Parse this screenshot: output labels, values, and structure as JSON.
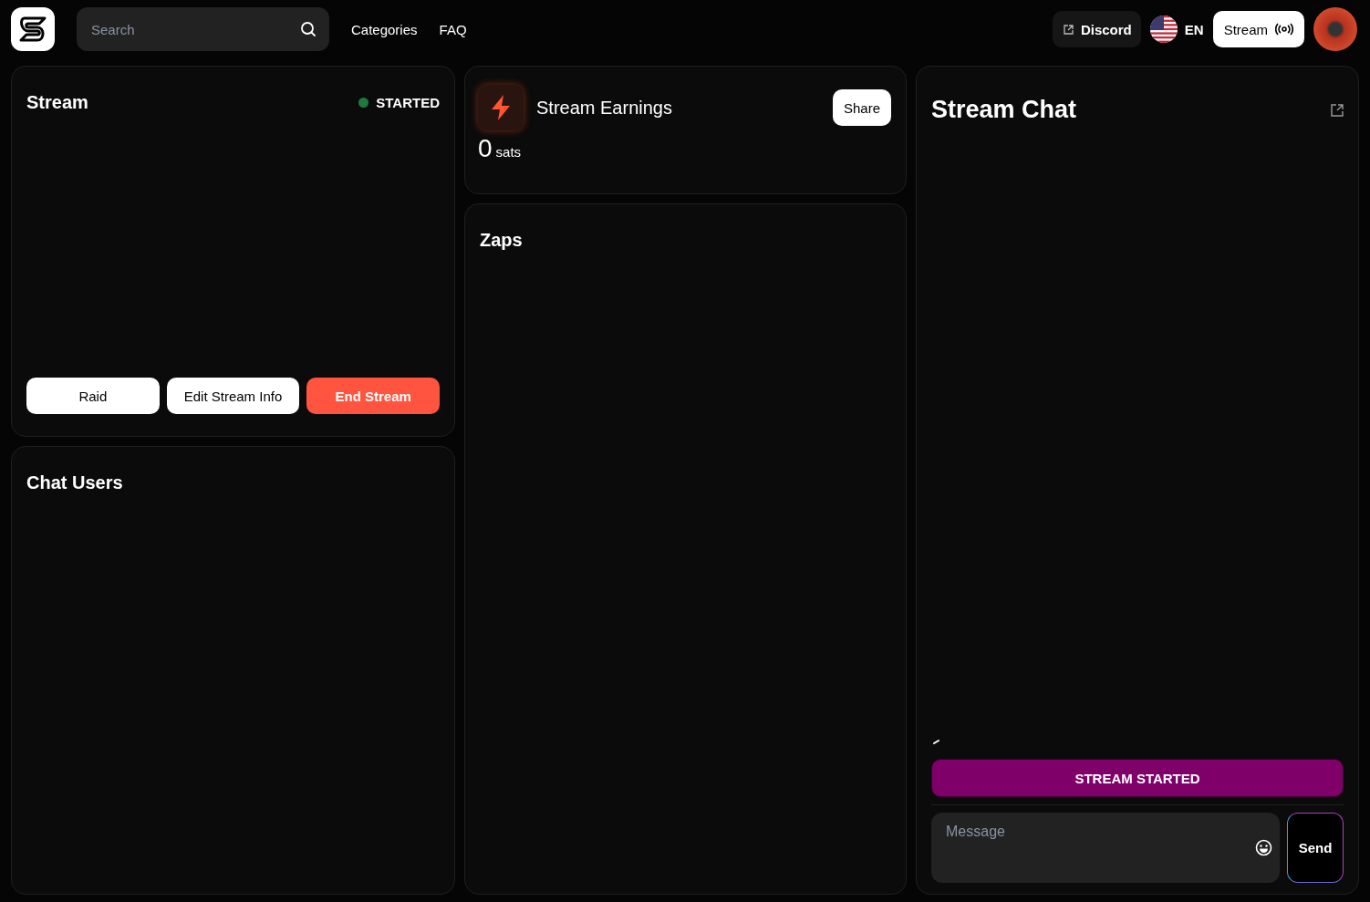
{
  "header": {
    "search": {
      "placeholder": "Search"
    },
    "nav": [
      "Categories",
      "FAQ"
    ],
    "discord": "Discord",
    "language": "EN",
    "stream_button": "Stream"
  },
  "stream_panel": {
    "title": "Stream",
    "status": "STARTED",
    "buttons": [
      {
        "label": "Raid",
        "kind": "plain"
      },
      {
        "label": "Edit Stream Info",
        "kind": "plain"
      },
      {
        "label": "End Stream",
        "kind": "danger"
      }
    ]
  },
  "chat_users": {
    "title": "Chat Users"
  },
  "earnings": {
    "title": "Stream Earnings",
    "share_button": "Share",
    "amount": "0",
    "unit": "sats"
  },
  "zaps": {
    "title": "Zaps"
  },
  "chat": {
    "title": "Stream Chat",
    "banner": "STREAM STARTED",
    "message": {
      "placeholder": "Message"
    },
    "send_button": "Send"
  }
}
